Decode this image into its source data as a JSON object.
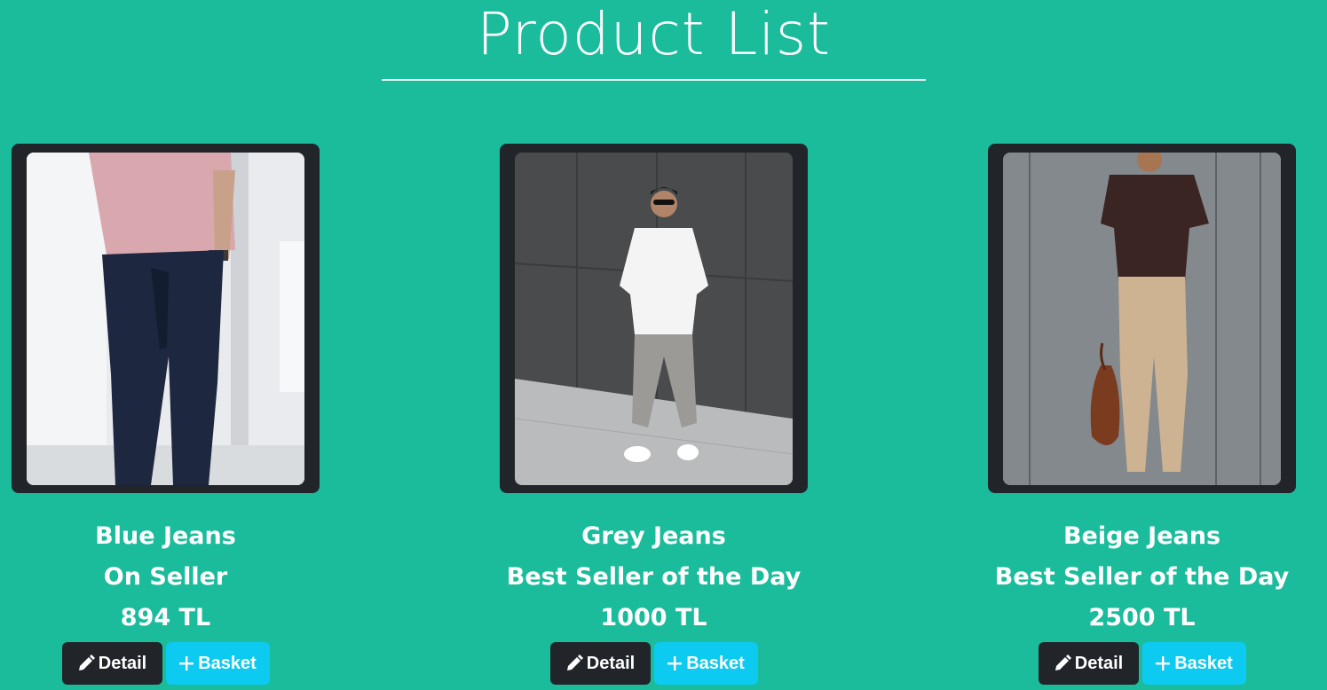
{
  "header": {
    "title": "Product List"
  },
  "products": [
    {
      "name": "Blue Jeans",
      "tag": "On Seller",
      "price": "894 TL",
      "image_alt": "Man wearing blue jeans and pink t-shirt"
    },
    {
      "name": "Grey Jeans",
      "tag": "Best Seller of the Day",
      "price": "1000 TL",
      "image_alt": "Man wearing grey jeans and white shirt"
    },
    {
      "name": "Beige Jeans",
      "tag": "Best Seller of the Day",
      "price": "2500 TL",
      "image_alt": "Man wearing beige trousers and brown polo"
    }
  ],
  "actions": {
    "detail_label": "Detail",
    "detail_icon": "pencil-icon",
    "basket_label": "Basket",
    "basket_icon": "plus-icon"
  },
  "colors": {
    "background": "#1abc9c",
    "card": "#212529",
    "detail_button": "#212529",
    "basket_button": "#0dcaf0"
  }
}
